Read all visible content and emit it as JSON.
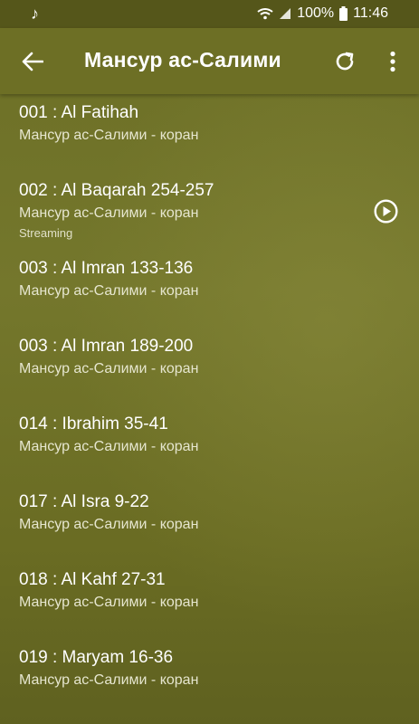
{
  "statusbar": {
    "battery_percent": "100%",
    "time": "11:46"
  },
  "appbar": {
    "title": "Мансур ас-Салими"
  },
  "tracks": [
    {
      "title": "001 : Al Fatihah",
      "subtitle": "Мансур ас-Салими - коран"
    },
    {
      "title": "002 : Al Baqarah 254-257",
      "subtitle": "Мансур ас-Салими - коран",
      "status": "Streaming"
    },
    {
      "title": "003 : Al Imran 133-136",
      "subtitle": "Мансур ас-Салими - коран"
    },
    {
      "title": "003 : Al Imran 189-200",
      "subtitle": "Мансур ас-Салими - коран"
    },
    {
      "title": "014 : Ibrahim 35-41",
      "subtitle": "Мансур ас-Салими - коран"
    },
    {
      "title": "017 : Al Isra 9-22",
      "subtitle": "Мансур ас-Салими - коран"
    },
    {
      "title": "018 : Al Kahf 27-31",
      "subtitle": "Мансур ас-Салими - коран"
    },
    {
      "title": "019 : Maryam 16-36",
      "subtitle": "Мансур ас-Салими - коран"
    }
  ]
}
